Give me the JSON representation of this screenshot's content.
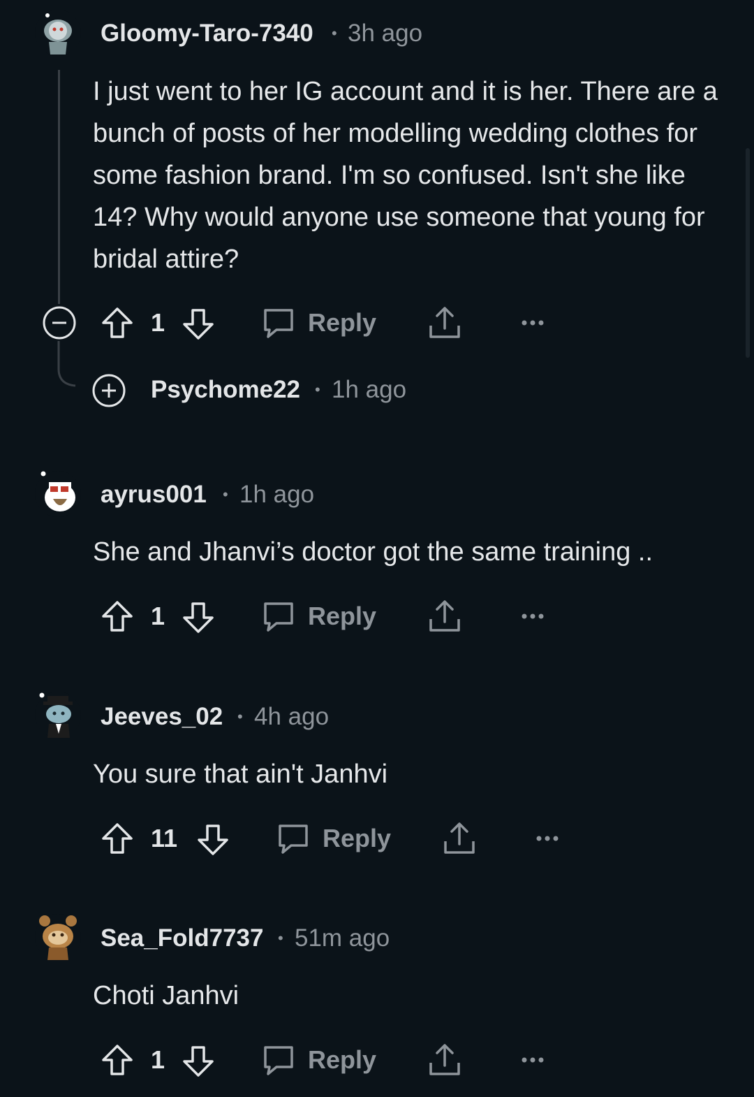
{
  "comments": [
    {
      "username": "Gloomy-Taro-7340",
      "time": "3h ago",
      "text": "I just went to her IG account and it is her. There are a bunch of posts of her modelling wedding clothes for some fashion brand. I'm so confused. Isn't she like 14? Why would anyone use someone that young for bridal attire?",
      "votes": "1",
      "reply_label": "Reply"
    },
    {
      "username": "Psychome22",
      "time": "1h ago"
    },
    {
      "username": "ayrus001",
      "time": "1h ago",
      "text": "She and Jhanvi’s doctor got the same training ..",
      "votes": "1",
      "reply_label": "Reply"
    },
    {
      "username": "Jeeves_02",
      "time": "4h ago",
      "text": "You sure that ain't Janhvi",
      "votes": "11",
      "reply_label": "Reply"
    },
    {
      "username": "Sea_Fold7737",
      "time": "51m ago",
      "text": "Choti Janhvi",
      "votes": "1",
      "reply_label": "Reply"
    }
  ],
  "separator": "•",
  "colors": {
    "background": "#0b1319",
    "text": "#e6e8ea",
    "muted": "#8f959b",
    "thread_line": "#3a4046"
  },
  "icons": [
    "upvote-icon",
    "downvote-icon",
    "reply-bubble-icon",
    "share-icon",
    "more-options-icon",
    "collapse-minus-icon",
    "expand-plus-icon"
  ]
}
